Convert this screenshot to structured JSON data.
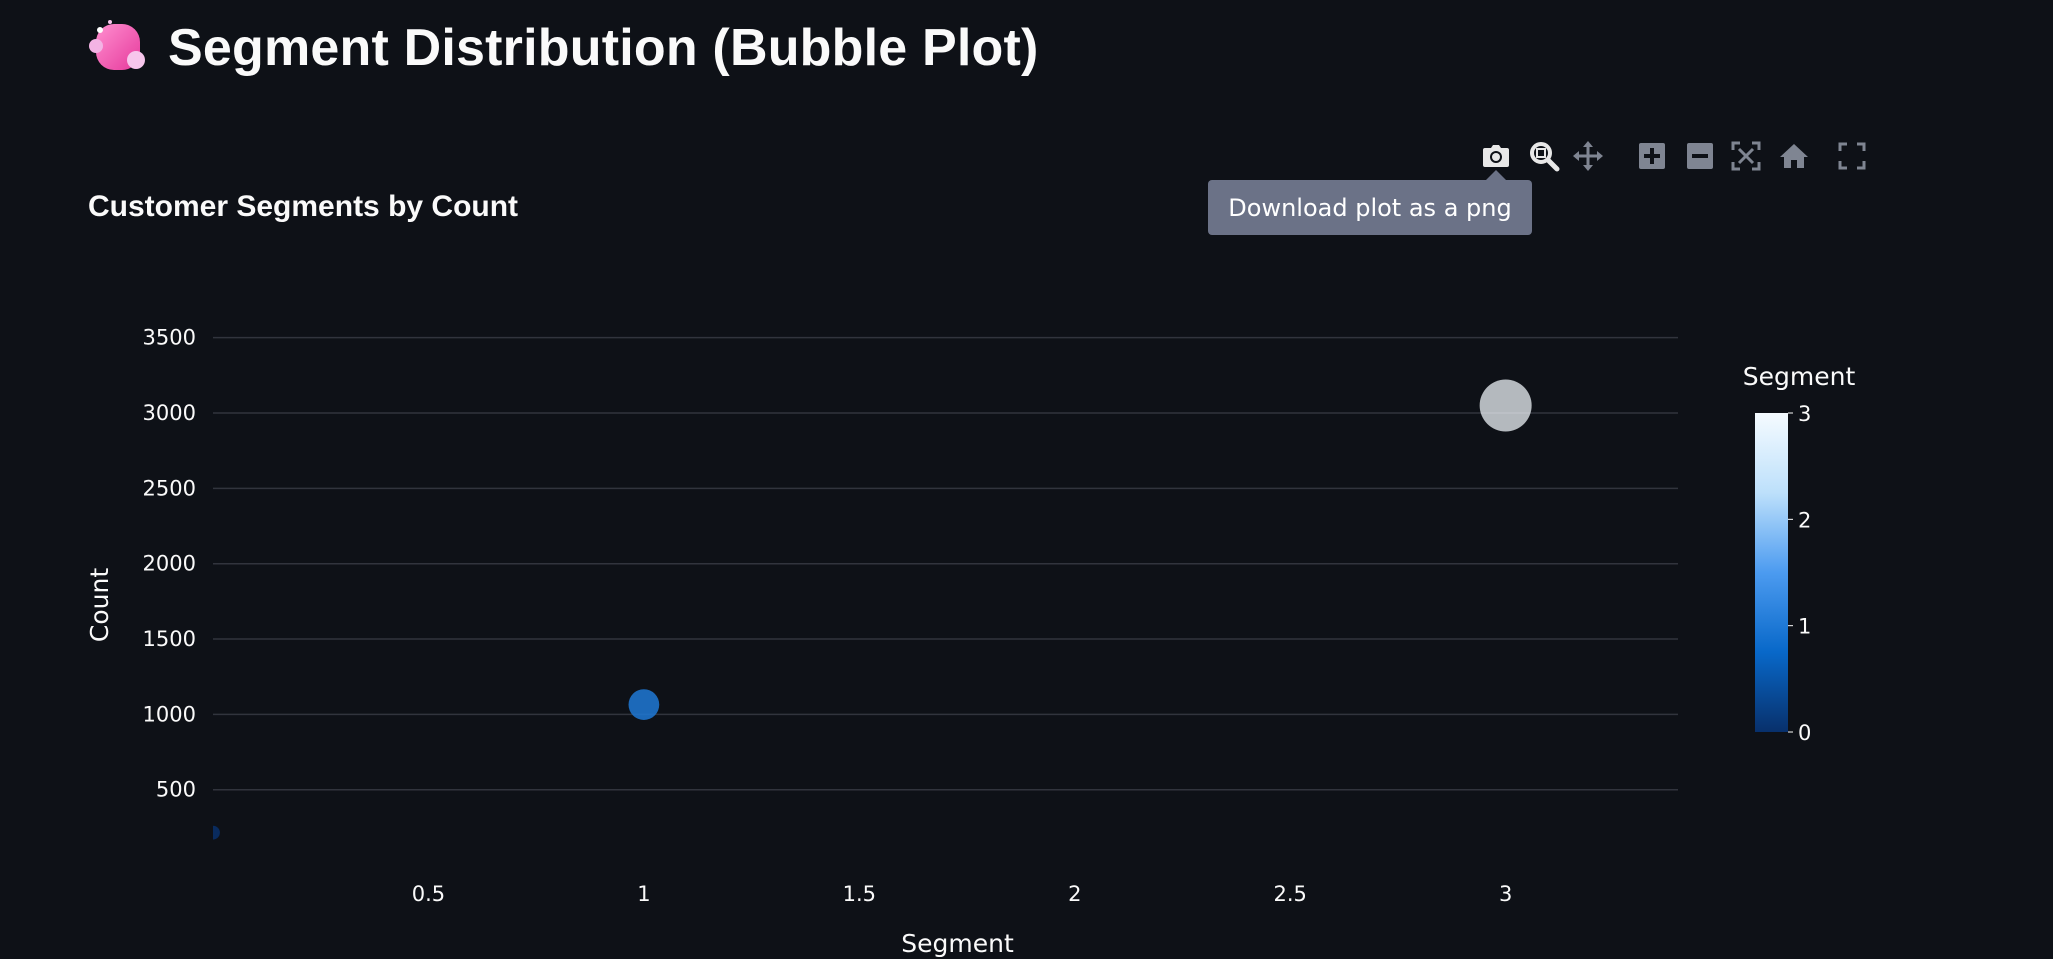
{
  "header": {
    "title": "Segment Distribution (Bubble Plot)",
    "icon": "bubbles-icon"
  },
  "modebar": {
    "buttons": [
      {
        "name": "camera-icon",
        "label": "Download plot as a png"
      },
      {
        "name": "zoom-icon",
        "label": "Zoom"
      },
      {
        "name": "pan-icon",
        "label": "Pan"
      },
      {
        "name": "zoom-in-icon",
        "label": "Zoom in"
      },
      {
        "name": "zoom-out-icon",
        "label": "Zoom out"
      },
      {
        "name": "autoscale-icon",
        "label": "Autoscale"
      },
      {
        "name": "reset-axes-icon",
        "label": "Reset axes"
      },
      {
        "name": "fullscreen-icon",
        "label": "Fullscreen"
      }
    ],
    "tooltip": "Download plot as a png"
  },
  "chart_data": {
    "type": "scatter",
    "title": "Customer Segments by Count",
    "xlabel": "Segment",
    "ylabel": "Count",
    "xlim": [
      0,
      3.4
    ],
    "ylim": [
      100,
      3750
    ],
    "x_ticks": [
      0.5,
      1,
      1.5,
      2,
      2.5,
      3
    ],
    "x_tick_labels": [
      "0.5",
      "1",
      "1.5",
      "2",
      "2.5",
      "3"
    ],
    "y_ticks": [
      500,
      1000,
      1500,
      2000,
      2500,
      3000,
      3500
    ],
    "y_tick_labels": [
      "500",
      "1000",
      "1500",
      "2000",
      "2500",
      "3000",
      "3500"
    ],
    "grid": true,
    "points": [
      {
        "x": 0,
        "y": 215,
        "color_value": 0
      },
      {
        "x": 1,
        "y": 1065,
        "color_value": 1
      },
      {
        "x": 3,
        "y": 3050,
        "color_value": 3
      }
    ],
    "colorbar": {
      "title": "Segment",
      "range": [
        0,
        3
      ],
      "tick_values": [
        0,
        1,
        2,
        3
      ],
      "tick_labels": [
        "0",
        "1",
        "2",
        "3"
      ],
      "colorscale": [
        "#08306b",
        "#0868c9",
        "#4c9bf0",
        "#bde0fb",
        "#f5fbff"
      ]
    }
  }
}
